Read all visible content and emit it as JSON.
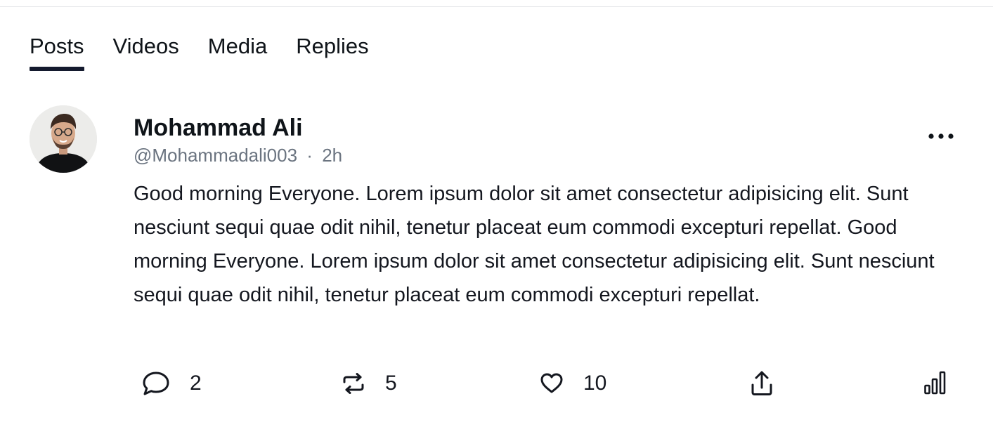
{
  "tabs": [
    {
      "label": "Posts",
      "active": true
    },
    {
      "label": "Videos",
      "active": false
    },
    {
      "label": "Media",
      "active": false
    },
    {
      "label": "Replies",
      "active": false
    }
  ],
  "post": {
    "author_name": "Mohammad Ali",
    "handle": "@Mohammadali003",
    "separator": "·",
    "time": "2h",
    "body": "Good morning Everyone. Lorem ipsum dolor sit amet consectetur adipisicing elit. Sunt nesciunt sequi quae odit nihil, tenetur placeat eum commodi excepturi repellat. Good morning Everyone. Lorem ipsum dolor sit amet consectetur adipisicing elit. Sunt nesciunt sequi quae odit nihil, tenetur placeat eum commodi excepturi repellat.",
    "actions": {
      "replies": {
        "icon": "comment-icon",
        "count": "2"
      },
      "reposts": {
        "icon": "repost-icon",
        "count": "5"
      },
      "likes": {
        "icon": "heart-icon",
        "count": "10"
      },
      "share": {
        "icon": "share-icon"
      },
      "stats": {
        "icon": "stats-icon"
      }
    },
    "more_icon": "more-dots-icon",
    "avatar_icon": "avatar-photo"
  },
  "colors": {
    "text": "#0f1419",
    "muted": "#6b7480",
    "tab_indicator": "#141a2e",
    "divider": "#e6e7ea"
  }
}
